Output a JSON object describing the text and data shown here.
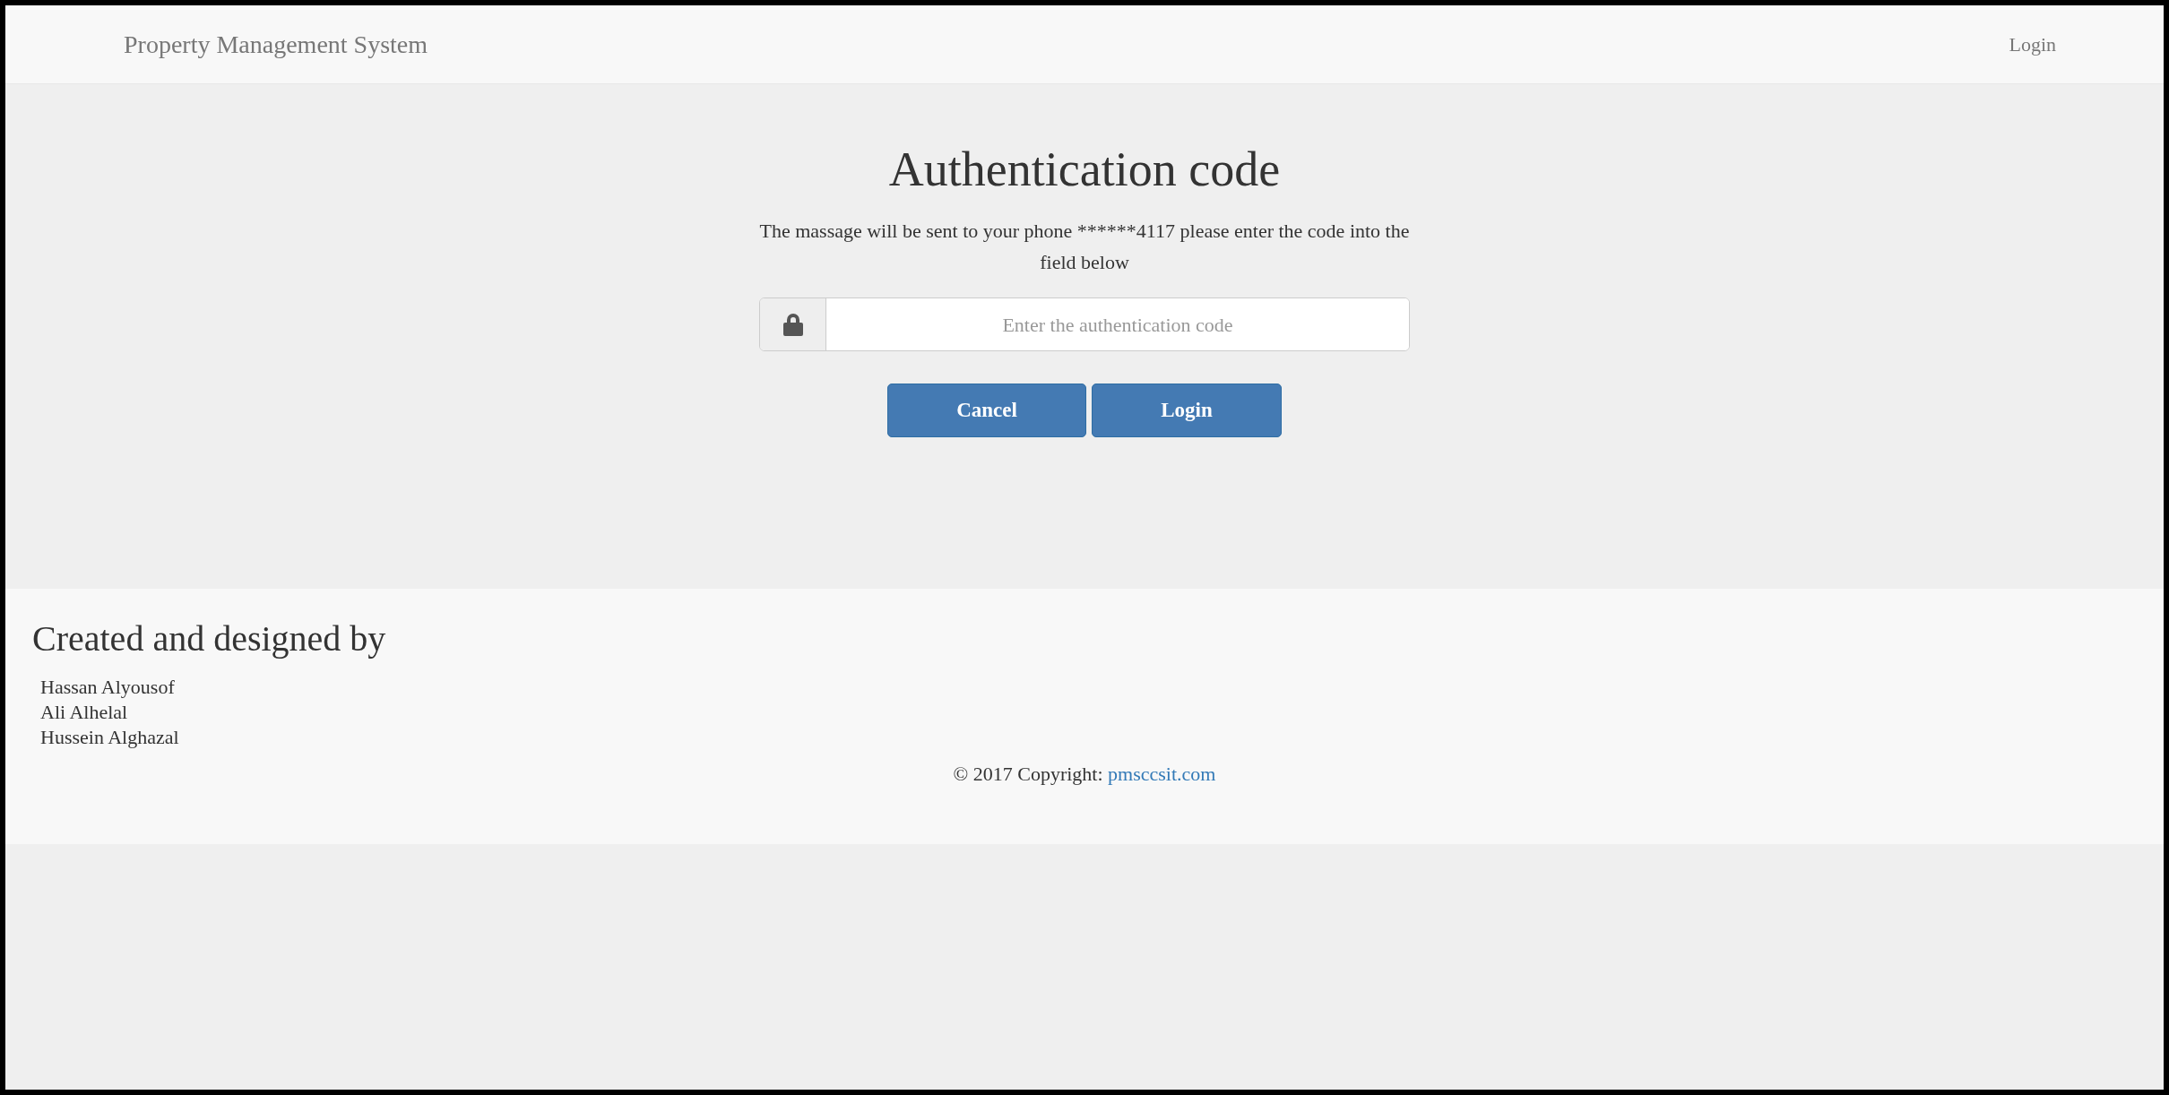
{
  "navbar": {
    "brand": "Property Management System",
    "link": "Login"
  },
  "form": {
    "title": "Authentication code",
    "message": "The massage will be sent to your phone ******4117 please enter the code into the field below",
    "placeholder": "Enter the authentication code",
    "buttons": [
      "Cancel",
      "Login"
    ]
  },
  "footer": {
    "heading": "Created and designed by",
    "names": [
      "Hassan Alyousof",
      "Ali Alhelal",
      "Hussein Alghazal"
    ],
    "copyright": "© 2017 Copyright:",
    "link": "pmsccsit.com"
  }
}
